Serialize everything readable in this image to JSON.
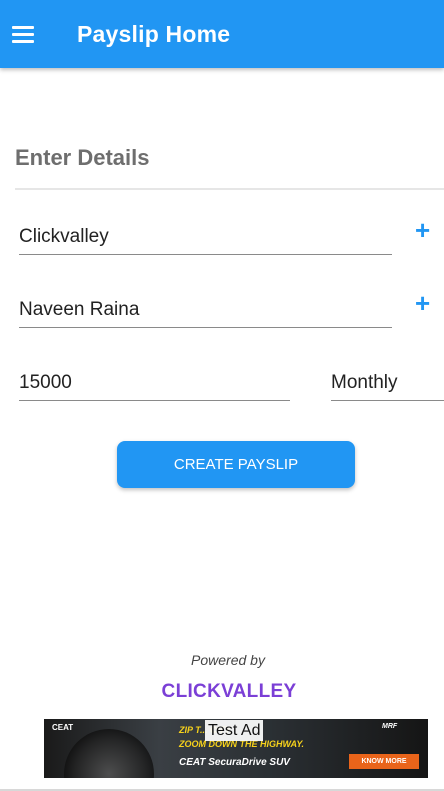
{
  "app_bar": {
    "title": "Payslip Home",
    "menu_icon": "hamburger-menu-icon",
    "color": "#2196f3"
  },
  "form": {
    "section_title": "Enter Details",
    "company_value": "Clickvalley",
    "employee_value": "Naveen Raina",
    "salary_value": "15000",
    "period_selected": "Monthly",
    "add_icon": "plus-icon"
  },
  "actions": {
    "create_label": "CREATE PAYSLIP"
  },
  "footer": {
    "powered_by": "Powered by",
    "brand": "CLICKVALLEY",
    "brand_color": "#7b3fd6"
  },
  "ad": {
    "label": "Test Ad",
    "advertiser": "CEAT",
    "headline_1": "ZIP T... CITY.",
    "headline_2": "ZOOM DOWN THE HIGHWAY.",
    "product": "CEAT SecuraDrive SUV",
    "partner": "MRF",
    "cta": "KNOW MORE"
  }
}
